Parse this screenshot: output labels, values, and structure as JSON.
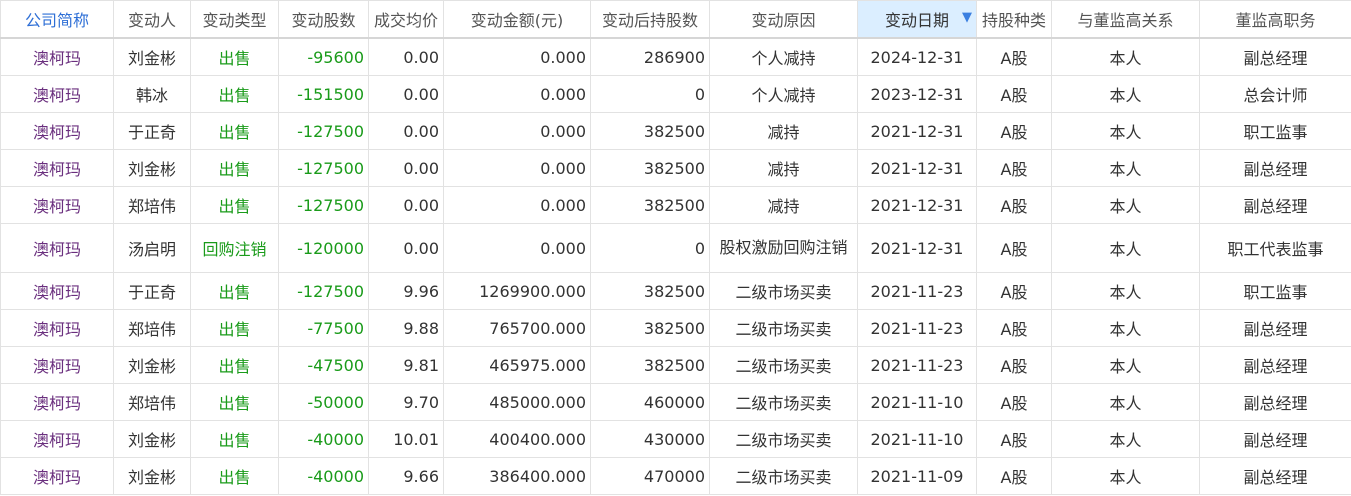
{
  "table": {
    "columns": [
      "公司简称",
      "变动人",
      "变动类型",
      "变动股数",
      "成交均价",
      "变动金额(元)",
      "变动后持股数",
      "变动原因",
      "变动日期",
      "持股种类",
      "与董监高关系",
      "董监高职务"
    ],
    "sort_column": "变动日期",
    "sort_direction": "descending",
    "rows": [
      {
        "company": "澳柯玛",
        "person": "刘金彬",
        "type": "出售",
        "shares": "-95600",
        "price": "0.00",
        "amount": "0.000",
        "holding": "286900",
        "reason": "个人减持",
        "date": "2024-12-31",
        "share_type": "A股",
        "relation": "本人",
        "position": "副总经理"
      },
      {
        "company": "澳柯玛",
        "person": "韩冰",
        "type": "出售",
        "shares": "-151500",
        "price": "0.00",
        "amount": "0.000",
        "holding": "0",
        "reason": "个人减持",
        "date": "2023-12-31",
        "share_type": "A股",
        "relation": "本人",
        "position": "总会计师"
      },
      {
        "company": "澳柯玛",
        "person": "于正奇",
        "type": "出售",
        "shares": "-127500",
        "price": "0.00",
        "amount": "0.000",
        "holding": "382500",
        "reason": "减持",
        "date": "2021-12-31",
        "share_type": "A股",
        "relation": "本人",
        "position": "职工监事"
      },
      {
        "company": "澳柯玛",
        "person": "刘金彬",
        "type": "出售",
        "shares": "-127500",
        "price": "0.00",
        "amount": "0.000",
        "holding": "382500",
        "reason": "减持",
        "date": "2021-12-31",
        "share_type": "A股",
        "relation": "本人",
        "position": "副总经理"
      },
      {
        "company": "澳柯玛",
        "person": "郑培伟",
        "type": "出售",
        "shares": "-127500",
        "price": "0.00",
        "amount": "0.000",
        "holding": "382500",
        "reason": "减持",
        "date": "2021-12-31",
        "share_type": "A股",
        "relation": "本人",
        "position": "副总经理"
      },
      {
        "company": "澳柯玛",
        "person": "汤启明",
        "type": "回购注销",
        "shares": "-120000",
        "price": "0.00",
        "amount": "0.000",
        "holding": "0",
        "reason": "股权激励回购注销",
        "date": "2021-12-31",
        "share_type": "A股",
        "relation": "本人",
        "position": "职工代表监事"
      },
      {
        "company": "澳柯玛",
        "person": "于正奇",
        "type": "出售",
        "shares": "-127500",
        "price": "9.96",
        "amount": "1269900.000",
        "holding": "382500",
        "reason": "二级市场买卖",
        "date": "2021-11-23",
        "share_type": "A股",
        "relation": "本人",
        "position": "职工监事"
      },
      {
        "company": "澳柯玛",
        "person": "郑培伟",
        "type": "出售",
        "shares": "-77500",
        "price": "9.88",
        "amount": "765700.000",
        "holding": "382500",
        "reason": "二级市场买卖",
        "date": "2021-11-23",
        "share_type": "A股",
        "relation": "本人",
        "position": "副总经理"
      },
      {
        "company": "澳柯玛",
        "person": "刘金彬",
        "type": "出售",
        "shares": "-47500",
        "price": "9.81",
        "amount": "465975.000",
        "holding": "382500",
        "reason": "二级市场买卖",
        "date": "2021-11-23",
        "share_type": "A股",
        "relation": "本人",
        "position": "副总经理"
      },
      {
        "company": "澳柯玛",
        "person": "郑培伟",
        "type": "出售",
        "shares": "-50000",
        "price": "9.70",
        "amount": "485000.000",
        "holding": "460000",
        "reason": "二级市场买卖",
        "date": "2021-11-10",
        "share_type": "A股",
        "relation": "本人",
        "position": "副总经理"
      },
      {
        "company": "澳柯玛",
        "person": "刘金彬",
        "type": "出售",
        "shares": "-40000",
        "price": "10.01",
        "amount": "400400.000",
        "holding": "430000",
        "reason": "二级市场买卖",
        "date": "2021-11-10",
        "share_type": "A股",
        "relation": "本人",
        "position": "副总经理"
      },
      {
        "company": "澳柯玛",
        "person": "刘金彬",
        "type": "出售",
        "shares": "-40000",
        "price": "9.66",
        "amount": "386400.000",
        "holding": "470000",
        "reason": "二级市场买卖",
        "date": "2021-11-09",
        "share_type": "A股",
        "relation": "本人",
        "position": "副总经理"
      }
    ]
  },
  "colors": {
    "company_link": "#6a2f7e",
    "change_green": "#1a9b1a",
    "sorted_header_bg": "#dbeeff",
    "first_header_blue": "#2e6fd6"
  },
  "icons": {
    "sort": "sort-descending-icon"
  }
}
